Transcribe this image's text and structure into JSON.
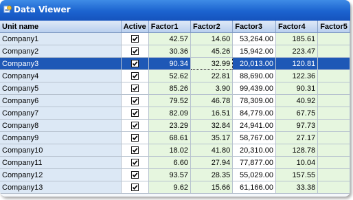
{
  "window": {
    "title": "Data Viewer",
    "icon": "data-viewer-app-icon"
  },
  "columns": [
    "Unit name",
    "Active",
    "Factor1",
    "Factor2",
    "Factor3",
    "Factor4",
    "Factor5"
  ],
  "selected_row": 2,
  "focused_cell": {
    "row": 2,
    "column": "Factor2"
  },
  "rows": [
    {
      "name": "Company1",
      "active": true,
      "f1": "42.57",
      "f2": "14.60",
      "f3": "53,264.00",
      "f4": "185.61"
    },
    {
      "name": "Company2",
      "active": true,
      "f1": "30.36",
      "f2": "45.26",
      "f3": "15,942.00",
      "f4": "223.47"
    },
    {
      "name": "Company3",
      "active": true,
      "f1": "90.34",
      "f2": "32.99",
      "f3": "20,013.00",
      "f4": "120.81"
    },
    {
      "name": "Company4",
      "active": true,
      "f1": "52.62",
      "f2": "22.81",
      "f3": "88,690.00",
      "f4": "122.36"
    },
    {
      "name": "Company5",
      "active": true,
      "f1": "85.26",
      "f2": "3.90",
      "f3": "99,439.00",
      "f4": "90.31"
    },
    {
      "name": "Company6",
      "active": true,
      "f1": "79.52",
      "f2": "46.78",
      "f3": "78,309.00",
      "f4": "40.92"
    },
    {
      "name": "Company7",
      "active": true,
      "f1": "82.09",
      "f2": "16.51",
      "f3": "84,779.00",
      "f4": "67.75"
    },
    {
      "name": "Company8",
      "active": true,
      "f1": "23.29",
      "f2": "32.84",
      "f3": "24,941.00",
      "f4": "97.73"
    },
    {
      "name": "Company9",
      "active": true,
      "f1": "68.61",
      "f2": "35.17",
      "f3": "58,767.00",
      "f4": "27.17"
    },
    {
      "name": "Company10",
      "active": true,
      "f1": "18.02",
      "f2": "41.80",
      "f3": "20,310.00",
      "f4": "128.78"
    },
    {
      "name": "Company11",
      "active": true,
      "f1": "6.60",
      "f2": "27.94",
      "f3": "77,877.00",
      "f4": "10.04"
    },
    {
      "name": "Company12",
      "active": true,
      "f1": "93.57",
      "f2": "28.35",
      "f3": "55,029.00",
      "f4": "157.55"
    },
    {
      "name": "Company13",
      "active": true,
      "f1": "9.62",
      "f2": "15.66",
      "f3": "61,166.00",
      "f4": "33.38"
    }
  ],
  "colors": {
    "title_bar": "#1c63cf",
    "selection": "#1e58b6",
    "name_cell": "#dce8f5",
    "numeric_cell": "#e6f6df"
  }
}
